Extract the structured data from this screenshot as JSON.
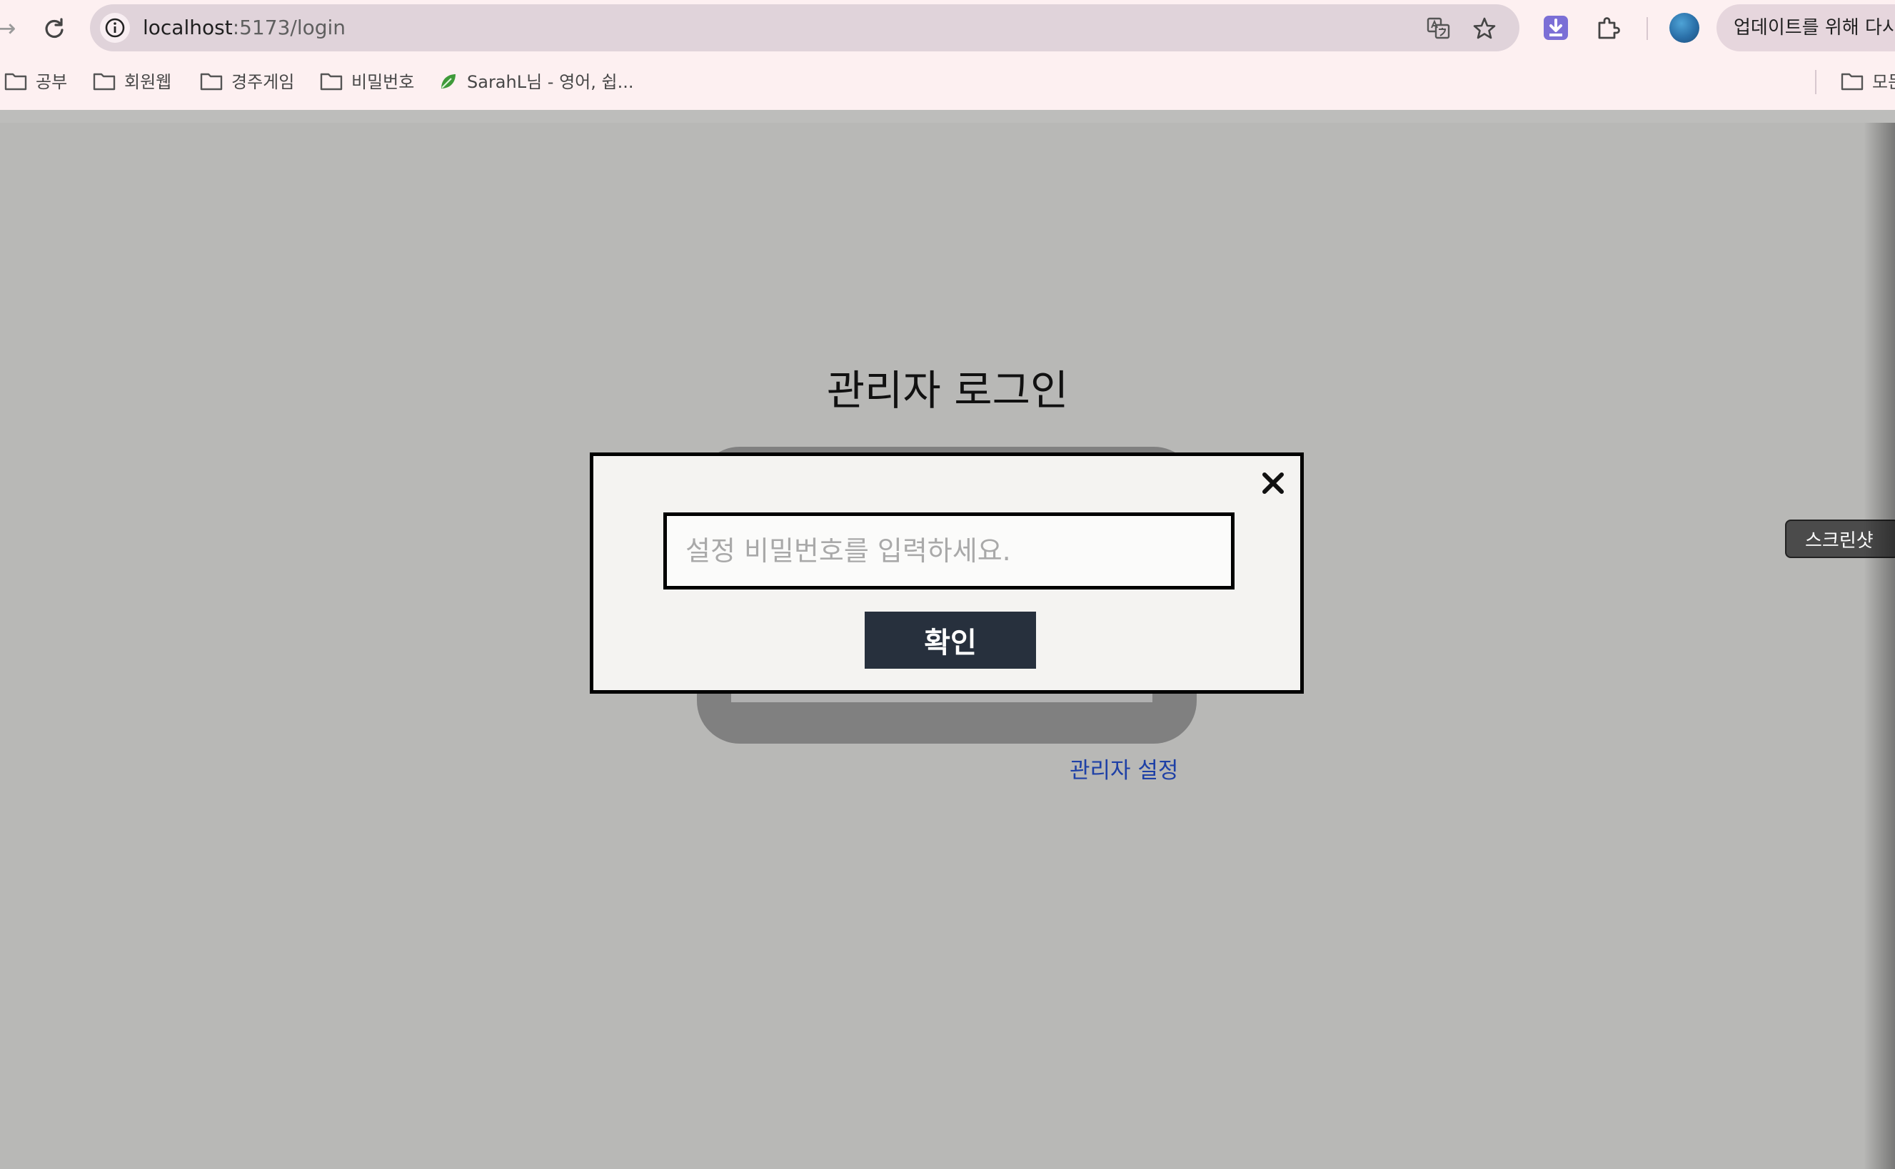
{
  "browser": {
    "url_host": "localhost",
    "url_path": ":5173/login",
    "update_button": "업데이트를 위해 다시",
    "bookmarks": [
      {
        "label": "공부",
        "icon": "folder-icon"
      },
      {
        "label": "회원웹",
        "icon": "folder-icon"
      },
      {
        "label": "경주게임",
        "icon": "folder-icon"
      },
      {
        "label": "비밀번호",
        "icon": "folder-icon"
      },
      {
        "label": "SarahL님 - 영어, 쉽...",
        "icon": "leaf-icon"
      }
    ],
    "all_bookmarks": "모든"
  },
  "page": {
    "title": "관리자 로그인",
    "admin_settings_link": "관리자 설정"
  },
  "modal": {
    "password_placeholder": "설정 비밀번호를 입력하세요.",
    "password_value": "",
    "confirm_label": "확인"
  },
  "floating": {
    "screenshot_label": "스크린샷"
  },
  "colors": {
    "page_bg": "#b8b8b6",
    "chrome_bg": "#fdf0f1",
    "confirm_bg": "#27303d",
    "link": "#1e40a6"
  }
}
